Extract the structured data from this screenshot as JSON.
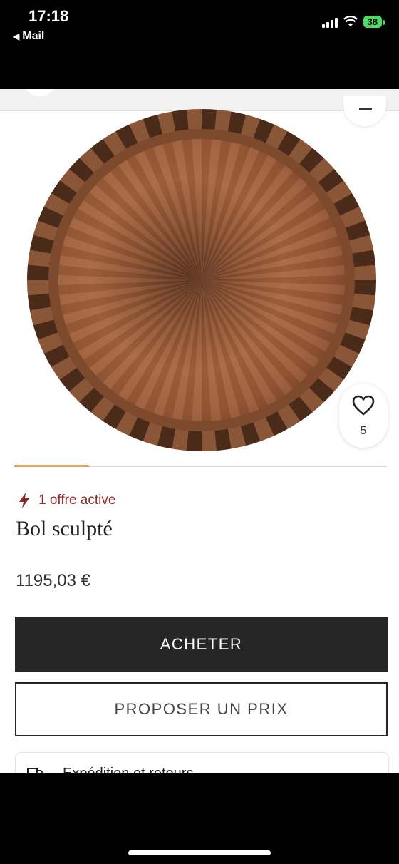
{
  "status_bar": {
    "time": "17:18",
    "back_label": "Mail",
    "battery": "38"
  },
  "product": {
    "likes": "5",
    "offer_text": "1 offre active",
    "title": "Bol sculpté",
    "price": "1195,03 €",
    "image_progress": 0.2
  },
  "actions": {
    "buy_label": "ACHETER",
    "propose_label": "PROPOSER UN PRIX"
  },
  "shipping": {
    "label": "Expédition et retours"
  },
  "colors": {
    "offer_accent": "#8c2b2b",
    "progress_accent": "#e0a45c",
    "button_dark": "#262626"
  },
  "icons": [
    "back-arrow-icon",
    "signal-icon",
    "wifi-icon",
    "battery-icon",
    "heart-icon",
    "bolt-icon",
    "truck-icon",
    "minus-icon"
  ]
}
